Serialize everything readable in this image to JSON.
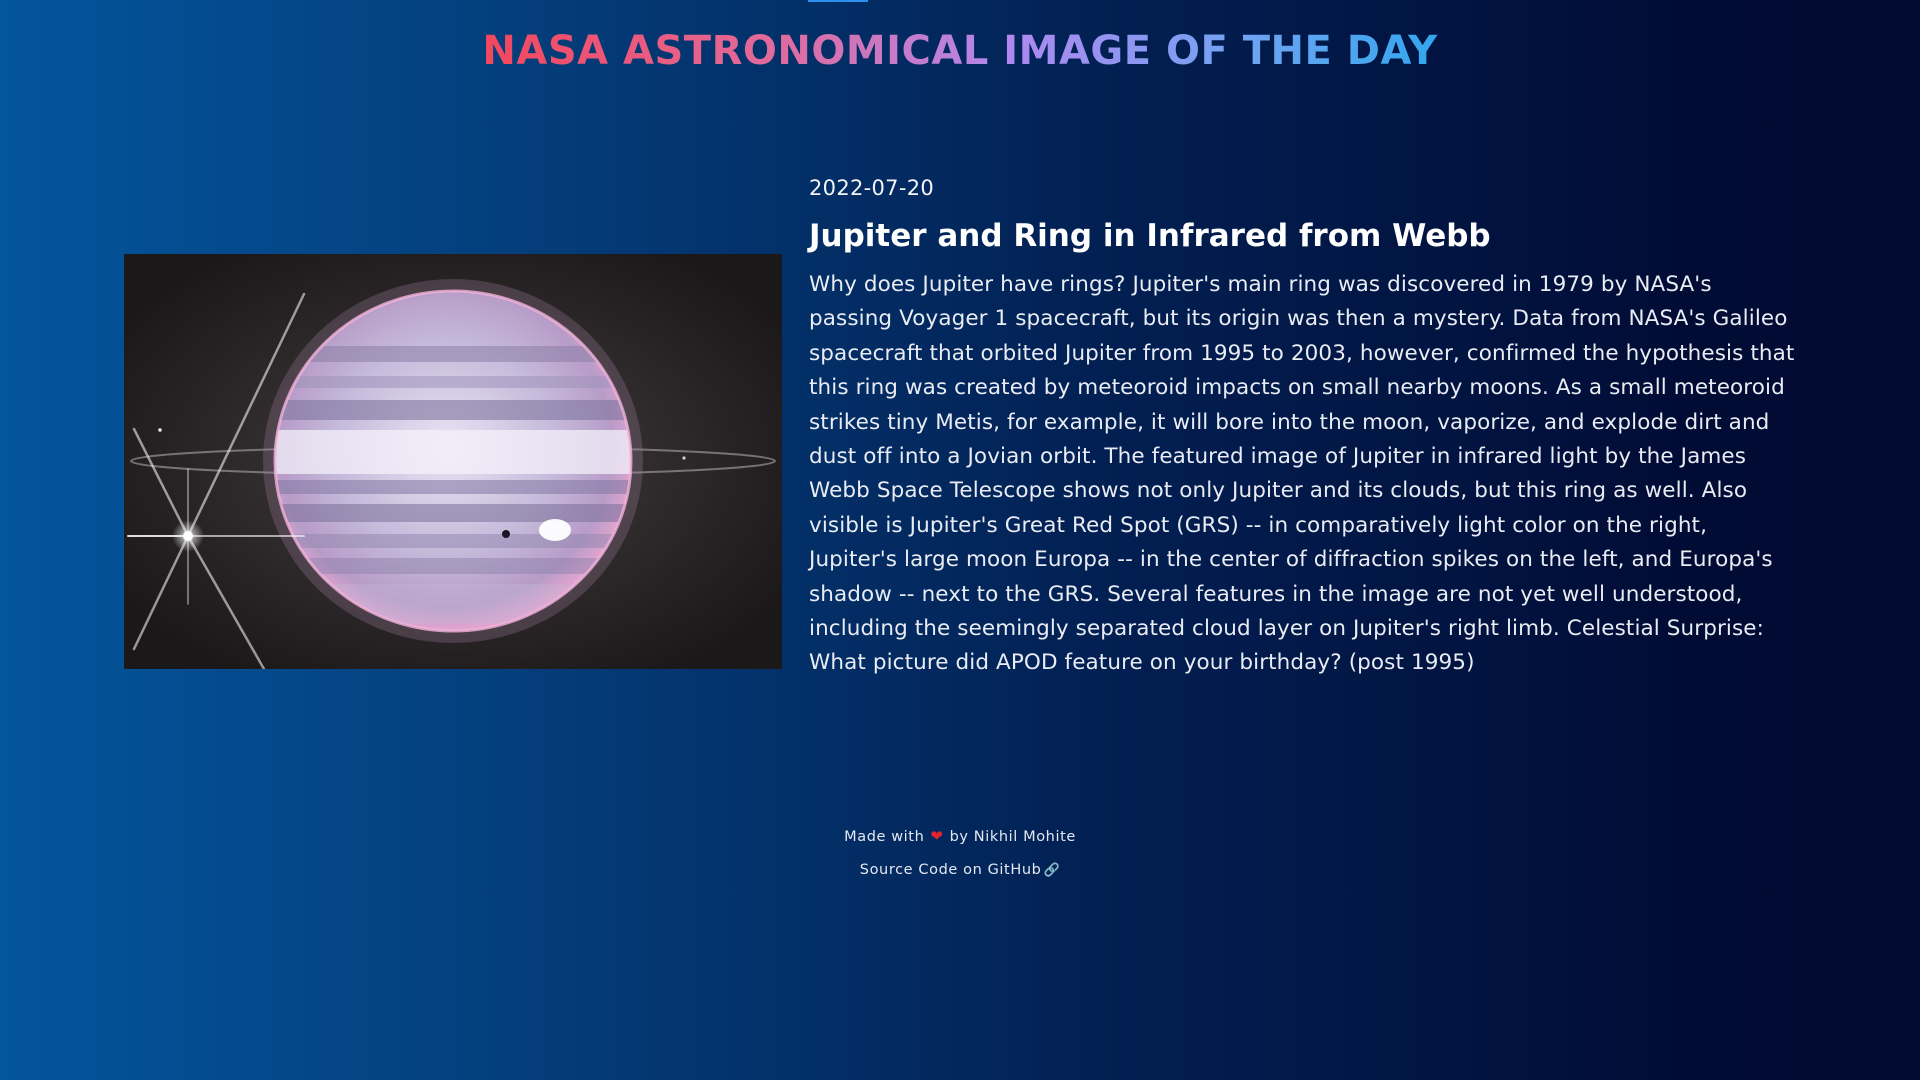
{
  "header": {
    "title": "NASA ASTRONOMICAL IMAGE OF THE DAY"
  },
  "apod": {
    "date": "2022-07-20",
    "title": "Jupiter and Ring in Infrared from Webb",
    "explanation": "Why does Jupiter have rings? Jupiter's main ring was discovered in 1979 by NASA's passing Voyager 1 spacecraft, but its origin was then a mystery. Data from NASA's Galileo spacecraft that orbited Jupiter from 1995 to 2003, however, confirmed the hypothesis that this ring was created by meteoroid impacts on small nearby moons. As a small meteoroid strikes tiny Metis, for example, it will bore into the moon, vaporize, and explode dirt and dust off into a Jovian orbit. The featured image of Jupiter in infrared light by the James Webb Space Telescope shows not only Jupiter and its clouds, but this ring as well. Also visible is Jupiter's Great Red Spot (GRS) -- in comparatively light color on the right, Jupiter's large moon Europa -- in the center of diffraction spikes on the left, and Europa's shadow -- next to the GRS. Several features in the image are not yet well understood, including the seemingly separated cloud layer on Jupiter's right limb. Celestial Surprise: What picture did APOD feature on your birthday? (post 1995)"
  },
  "footer": {
    "made_with": "Made with",
    "by": "by Nikhil Mohite",
    "source_link": "Source Code on GitHub",
    "heart_icon": "heart-icon",
    "link_icon": "link-icon"
  },
  "colors": {
    "background_left": "#03559c",
    "background_right": "#010a30",
    "title_gradient_start": "#f2475d",
    "title_gradient_mid": "#b088ef",
    "title_gradient_end": "#33a6ee",
    "heart": "#e0242f"
  }
}
